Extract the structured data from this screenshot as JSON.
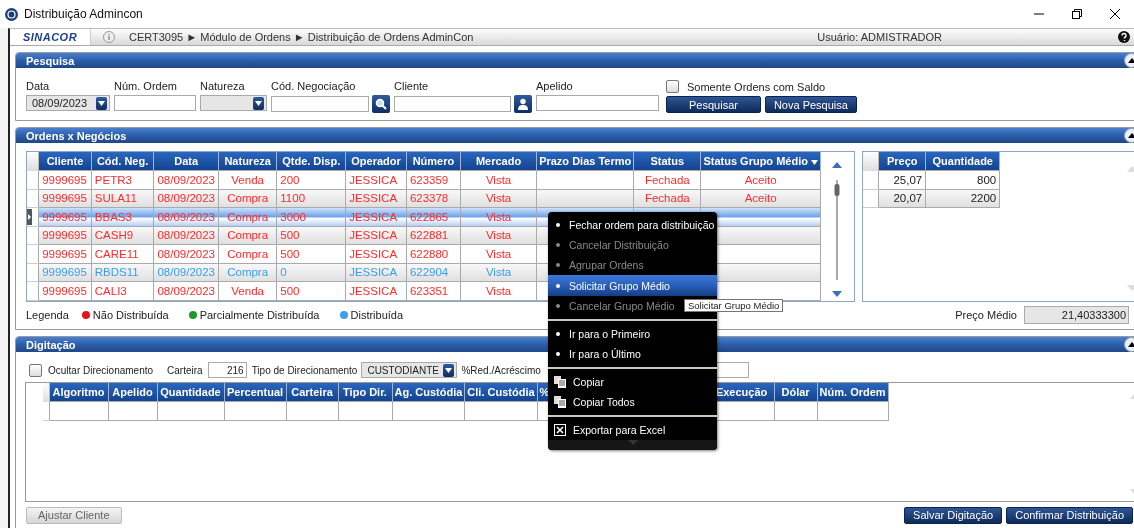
{
  "window": {
    "title": "Distribuição Admincon"
  },
  "top_bar": {
    "logo": "SINACOR",
    "breadcrumb": "CERT3095 ► Módulo de Ordens ► Distribuição de Ordens AdminCon",
    "user": "Usuário: ADMISTRADOR"
  },
  "search_panel": {
    "title": "Pesquisa",
    "fields": [
      {
        "kind": "date",
        "label": "Data",
        "value": "08/09/2023",
        "disabled": true
      },
      {
        "kind": "text",
        "label": "Núm. Ordem",
        "disabled": false
      },
      {
        "kind": "select",
        "label": "Natureza",
        "disabled": true
      },
      {
        "kind": "search",
        "label": "Cód. Negociação",
        "disabled": false
      },
      {
        "kind": "person",
        "label": "Cliente",
        "disabled": false
      },
      {
        "kind": "text",
        "label": "Apelido",
        "disabled": false
      }
    ],
    "only_balance": {
      "label": "Somente Ordens com Saldo",
      "checked": false
    },
    "buttons": [
      "Pesquisar",
      "Nova Pesquisa"
    ]
  },
  "orders_panel": {
    "title": "Ordens x Negócios",
    "columns": [
      "Cliente",
      "Cód. Neg.",
      "Data",
      "Natureza",
      "Qtde. Disp.",
      "Operador",
      "Número",
      "Mercado",
      "Prazo Dias Termo",
      "Status",
      "Status Grupo Médio"
    ],
    "rows": [
      {
        "cells": [
          "9999695",
          "PETR3",
          "08/09/2023",
          "Venda",
          "200",
          "JESSICA",
          "623359",
          "Vista",
          "",
          "Fechada",
          "Aceito"
        ],
        "color": "#ff2a2a",
        "selected": false
      },
      {
        "cells": [
          "9999695",
          "SULA11",
          "08/09/2023",
          "Compra",
          "1100",
          "JESSICA",
          "623378",
          "Vista",
          "",
          "Fechada",
          "Aceito"
        ],
        "color": "#ff2a2a",
        "selected": false
      },
      {
        "cells": [
          "9999695",
          "BBAS3",
          "08/09/2023",
          "Compra",
          "3000",
          "JESSICA",
          "622865",
          "Vista",
          "",
          "",
          ""
        ],
        "color": "#ff2a2a",
        "selected": true
      },
      {
        "cells": [
          "9999695",
          "CASH9",
          "08/09/2023",
          "Compra",
          "500",
          "JESSICA",
          "622881",
          "Vista",
          "",
          "",
          ""
        ],
        "color": "#ff2a2a",
        "selected": false
      },
      {
        "cells": [
          "9999695",
          "CARE11",
          "08/09/2023",
          "Compra",
          "500",
          "JESSICA",
          "622880",
          "Vista",
          "",
          "",
          ""
        ],
        "color": "#ff2a2a",
        "selected": false
      },
      {
        "cells": [
          "9999695",
          "RBDS11",
          "08/09/2023",
          "Compra",
          "0",
          "JESSICA",
          "622904",
          "Vista",
          "",
          "",
          ""
        ],
        "color": "#3a9df0",
        "selected": false
      },
      {
        "cells": [
          "9999695",
          "CALI3",
          "08/09/2023",
          "Venda",
          "500",
          "JESSICA",
          "623351",
          "Vista",
          "",
          "",
          ""
        ],
        "color": "#ff2a2a",
        "selected": false
      }
    ],
    "trades": {
      "columns": [
        "Preço",
        "Quantidade"
      ],
      "rows": [
        [
          "25,07",
          "800"
        ],
        [
          "20,07",
          "2200"
        ]
      ]
    },
    "legend": {
      "label": "Legenda",
      "items": [
        {
          "label": "Não Distribuída",
          "color": "#e8121b"
        },
        {
          "label": "Parcialmente Distribuída",
          "color": "#1a9a2a"
        },
        {
          "label": "Distribuída",
          "color": "#3a9df0"
        }
      ]
    },
    "average_price": {
      "label": "Preço Médio",
      "value": "21,40333300"
    }
  },
  "entry_panel": {
    "title": "Digitação",
    "hide_direction": {
      "label": "Ocultar Direcionamento",
      "checked": false
    },
    "wallet": {
      "label": "Carteira",
      "value": "216"
    },
    "direction_type": {
      "label": "Tipo de Direcionamento",
      "value": "CUSTODIANTE"
    },
    "percent_label": "%Red./Acréscimo",
    "columns": [
      "Algoritmo",
      "Apelido",
      "Quantidade",
      "Percentual",
      "Carteira",
      "Tipo Dir.",
      "Ag. Custódia",
      "Cli. Custódia",
      "%",
      "",
      "Execução",
      "Dólar",
      "Núm. Ordem"
    ],
    "adjust_button": {
      "label": "Ajustar Cliente",
      "disabled": true
    },
    "buttons": [
      "Salvar Digitação",
      "Confirmar Distribuição"
    ]
  },
  "context_menu": {
    "items": [
      {
        "kind": "bullet",
        "label": "Fechar ordem para distribuição",
        "disabled": false,
        "selected": false
      },
      {
        "kind": "bullet",
        "label": "Cancelar Distribuição",
        "disabled": true,
        "selected": false
      },
      {
        "kind": "bullet",
        "label": "Agrupar Ordens",
        "disabled": true,
        "selected": false
      },
      {
        "kind": "bullet",
        "label": "Solicitar Grupo Médio",
        "disabled": false,
        "selected": true
      },
      {
        "kind": "bullet",
        "label": "Cancelar Grupo Médio",
        "disabled": true,
        "selected": false
      },
      {
        "kind": "separator"
      },
      {
        "kind": "bullet",
        "label": "Ir para o Primeiro",
        "disabled": false,
        "selected": false
      },
      {
        "kind": "bullet",
        "label": "Ir para o Último",
        "disabled": false,
        "selected": false
      },
      {
        "kind": "separator"
      },
      {
        "kind": "copy",
        "label": "Copiar",
        "disabled": false,
        "selected": false
      },
      {
        "kind": "copy",
        "label": "Copiar Todos",
        "disabled": false,
        "selected": false
      },
      {
        "kind": "separator"
      },
      {
        "kind": "excel",
        "label": "Exportar para Excel",
        "disabled": false,
        "selected": false
      }
    ],
    "tooltip": "Solicitar Grupo Médio"
  }
}
